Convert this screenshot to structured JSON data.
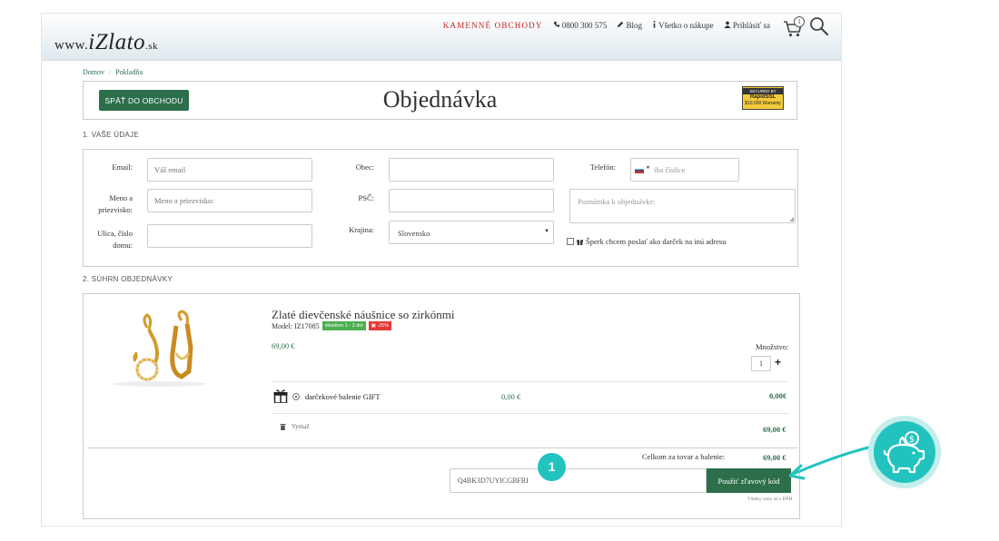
{
  "header": {
    "logo": {
      "prefix": "www.",
      "brand": "iZlato",
      "tld": ".sk"
    },
    "nav": {
      "stores": "KAMENNÉ OBCHODY",
      "phone": "0800 300 575",
      "blog": "Blog",
      "shopping_info": "Všetko o nákupe",
      "login": "Prihlásiť sa"
    },
    "cart_count": "1",
    "icons": [
      "phone-icon",
      "pencil-icon",
      "info-icon",
      "user-icon",
      "cart-icon",
      "search-icon"
    ]
  },
  "breadcrumb": {
    "home": "Domov",
    "separator": "/",
    "current": "Pokladňa"
  },
  "title_bar": {
    "back_button": "SPÄŤ DO OBCHODU",
    "title": "Objednávka",
    "ssl": {
      "top": "SECURED BY",
      "brand": "RapidSSL",
      "bottom": "$10,000 Warranty"
    }
  },
  "sections": {
    "details": "1. VAŠE ÚDAJE",
    "summary": "2. SÚHRN OBJEDNÁVKY"
  },
  "form": {
    "email": {
      "label": "Email:",
      "placeholder": "Váš email"
    },
    "name": {
      "label_line1": "Meno a",
      "label_line2": "priezvisko:",
      "placeholder": "Meno a priezvisko:"
    },
    "street": {
      "label_line1": "Ulica, číslo",
      "label_line2": "domu:"
    },
    "city": {
      "label": "Obec:"
    },
    "zip": {
      "label": "PSČ:"
    },
    "country": {
      "label": "Krajina:",
      "value": "Slovensko"
    },
    "phone": {
      "label": "Telefón:",
      "placeholder": "iba číslice"
    },
    "note": {
      "placeholder": "Poznámka k objednávke:"
    },
    "gift_checkbox": "Šperk chcem poslať ako darček na inú adresu"
  },
  "order": {
    "product": {
      "name": "Zlaté dievčenské náušnice so zirkónmi",
      "model": "Model: IZ17085",
      "stock_badge": "skladom 1 - 2 dni",
      "sale_badge": "-25%",
      "price": "69,00 €",
      "quantity_label": "Množstvo:",
      "quantity": "1",
      "plus": "+"
    },
    "gift_wrap": {
      "label": "darčekové balenie GIFT",
      "price": "0,00 €",
      "total": "0,00€"
    },
    "remove_label": "Vymaž",
    "row_total": "69,00 €",
    "sum_label": "Celkom za tovar a balenie:",
    "sum_value": "69,00 €",
    "coupon": {
      "code": "Q4BK3D7UYICGBFRI",
      "button": "Použiť zľavový kód"
    },
    "vat_note": "Všetky ceny sú s DPH"
  },
  "annotation": {
    "step": "1"
  },
  "colors": {
    "brand_green": "#2d6e4b",
    "accent_red": "#c4231f",
    "teal": "#22c3bf"
  }
}
